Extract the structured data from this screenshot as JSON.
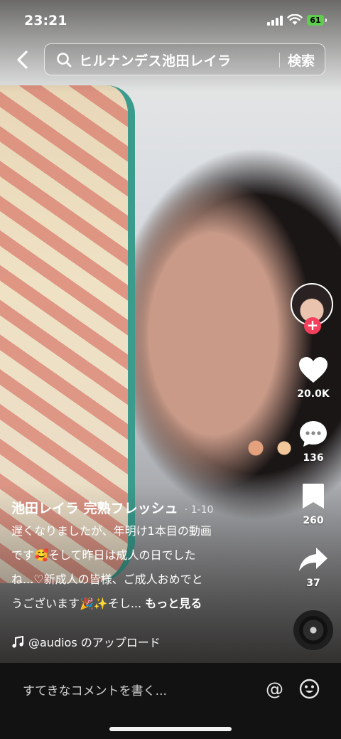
{
  "status_bar": {
    "time": "23:21",
    "battery": "61"
  },
  "search": {
    "query": "ヒルナンデス池田レイラ",
    "button_label": "検索"
  },
  "video": {
    "author": "池田レイラ 完熟フレッシュ",
    "date": "· 1-10",
    "caption_lines": [
      "遅くなりましたが、年明け1本目の動画",
      "です🥰そして昨日は成人の日でした",
      "ね...♡新成人の皆様、ご成人おめでと",
      "うございます🎉✨そし..."
    ],
    "more_label": "もっと見る",
    "music": "@audios のアップロード"
  },
  "actions": {
    "likes": "20.0K",
    "comments": "136",
    "saves": "260",
    "shares": "37"
  },
  "comment_bar": {
    "placeholder": "すてきなコメントを書く..."
  },
  "icons": [
    "back-icon",
    "search-icon",
    "heart-icon",
    "comment-icon",
    "bookmark-icon",
    "share-icon",
    "music-note-icon",
    "at-icon",
    "emoji-icon",
    "plus-icon"
  ]
}
